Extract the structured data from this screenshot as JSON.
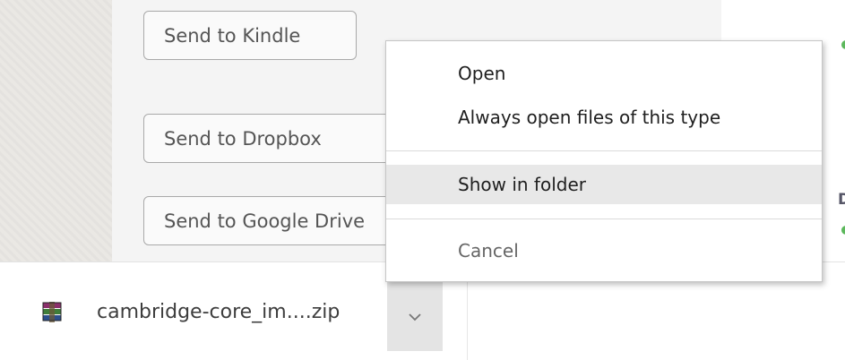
{
  "send_options": {
    "kindle_label": "Send to Kindle",
    "dropbox_label": "Send to Dropbox",
    "google_drive_label": "Send to Google Drive"
  },
  "context_menu": {
    "items": [
      {
        "label": "Open"
      },
      {
        "label": "Always open files of this type"
      },
      {
        "label": "Show in folder"
      },
      {
        "label": "Cancel"
      }
    ]
  },
  "download_bar": {
    "filename": "cambridge-core_im....zip",
    "file_icon": "winrar-archive-icon",
    "menu_icon": "chevron-down-icon"
  },
  "right_edge": {
    "letter": "D"
  },
  "colors": {
    "menu_highlight": "#e8e8e8",
    "status_dot": "#5cb85c",
    "chevron_button_bg": "#e4e4e4"
  }
}
